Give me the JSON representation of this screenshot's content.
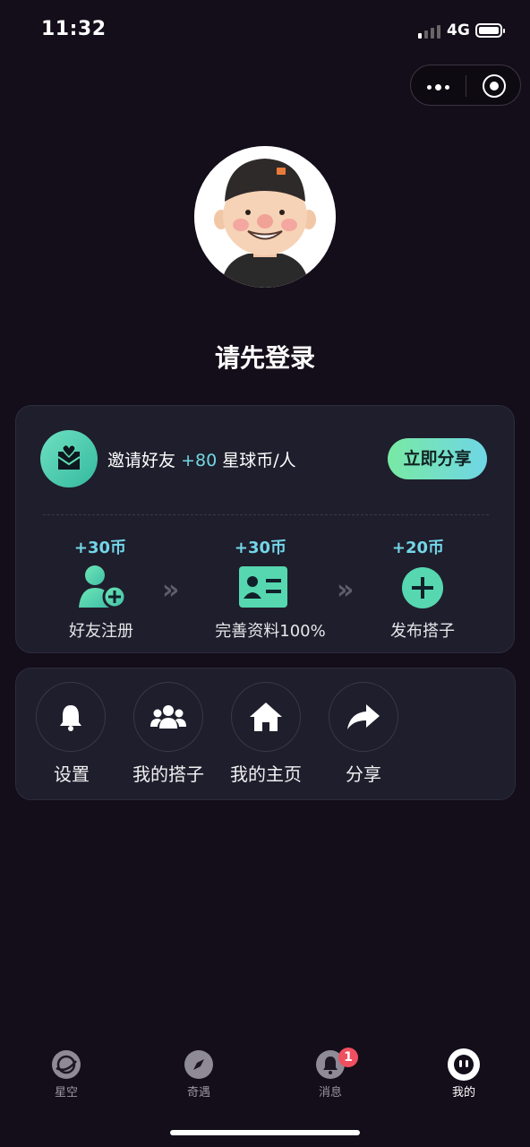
{
  "status_bar": {
    "time": "11:32",
    "network": "4G"
  },
  "profile": {
    "login_prompt": "请先登录"
  },
  "invite": {
    "prefix": "邀请好友",
    "bonus": "+80",
    "suffix": "星球币/人",
    "share_button": "立即分享"
  },
  "steps": [
    {
      "reward": "+30币",
      "label": "好友注册",
      "icon": "add-user-icon"
    },
    {
      "reward": "+30币",
      "label": "完善资料100%",
      "icon": "id-card-icon"
    },
    {
      "reward": "+20币",
      "label": "发布搭子",
      "icon": "plus-circle-icon"
    }
  ],
  "quick_actions": [
    {
      "label": "设置",
      "icon": "bell-icon"
    },
    {
      "label": "我的搭子",
      "icon": "group-icon"
    },
    {
      "label": "我的主页",
      "icon": "home-icon"
    },
    {
      "label": "分享",
      "icon": "share-arrow-icon"
    }
  ],
  "tab_bar": {
    "items": [
      {
        "label": "星空",
        "icon": "planet-icon",
        "active": false
      },
      {
        "label": "奇遇",
        "icon": "compass-icon",
        "active": false
      },
      {
        "label": "消息",
        "icon": "message-bell-icon",
        "active": false,
        "badge": "1"
      },
      {
        "label": "我的",
        "icon": "profile-face-icon",
        "active": true
      }
    ]
  },
  "colors": {
    "background": "#140d1a",
    "card": "#1f1e2c",
    "accent_teal": "#73d6e8",
    "accent_green": "#5fdcb0",
    "badge_red": "#ef4f5f"
  }
}
